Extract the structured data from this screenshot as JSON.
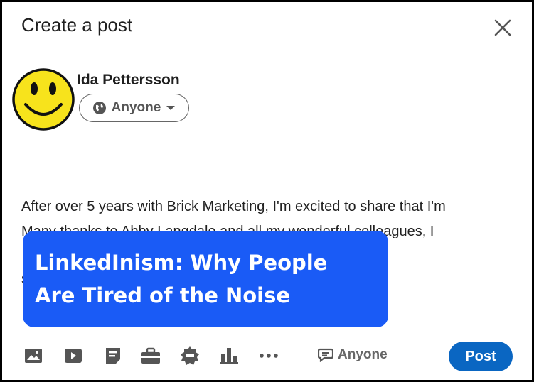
{
  "dialog": {
    "title": "Create a post",
    "close_icon": "close-icon"
  },
  "author": {
    "name": "Ida Pettersson",
    "avatar_icon": "smiley-face-icon",
    "audience_label": "Anyone"
  },
  "post": {
    "line1": "After over 5 years with Brick Marketing, I'm excited to share that I'm",
    "line2": "starting a new position as Video Editor at Ignite Visibility.",
    "line3": "Many thanks to Abby Langdale and all my wonderful colleagues, I"
  },
  "banner": {
    "line1": "LinkedInism: Why People",
    "line2": "Are Tired of the Noise",
    "color": "#1a5bf6"
  },
  "toolbar": {
    "icons": [
      "photo-icon",
      "video-icon",
      "document-icon",
      "briefcase-icon",
      "badge-icon",
      "poll-icon",
      "more-icon"
    ],
    "comment_audience_label": "Anyone",
    "post_label": "Post",
    "post_color": "#0a66c2"
  }
}
